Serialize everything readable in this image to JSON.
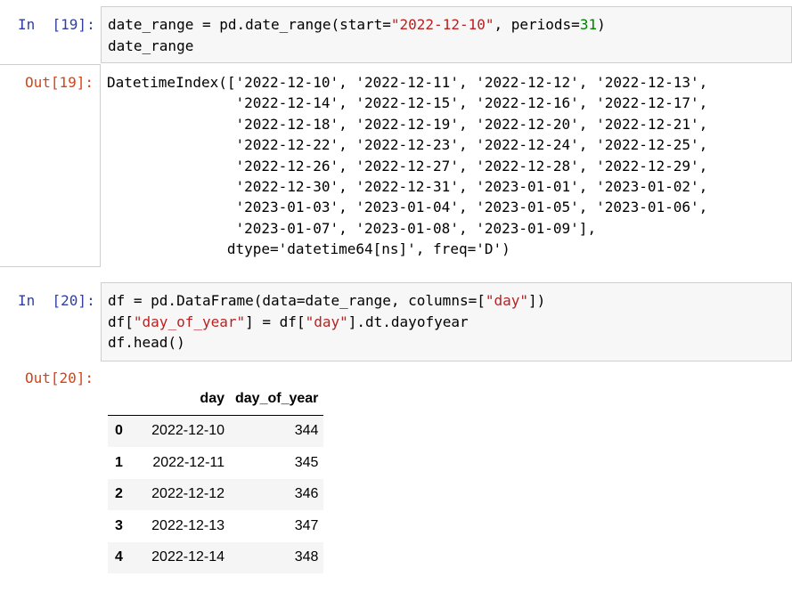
{
  "cell19": {
    "in_prompt": "In  [19]:",
    "out_prompt": "Out[19]:",
    "code_l1_a": "date_range = pd.date_range(start=",
    "code_l1_str": "\"2022-12-10\"",
    "code_l1_b": ", periods=",
    "code_l1_num": "31",
    "code_l1_c": ")",
    "code_l2": "date_range",
    "output_lines": [
      "DatetimeIndex(['2022-12-10', '2022-12-11', '2022-12-12', '2022-12-13',",
      "               '2022-12-14', '2022-12-15', '2022-12-16', '2022-12-17',",
      "               '2022-12-18', '2022-12-19', '2022-12-20', '2022-12-21',",
      "               '2022-12-22', '2022-12-23', '2022-12-24', '2022-12-25',",
      "               '2022-12-26', '2022-12-27', '2022-12-28', '2022-12-29',",
      "               '2022-12-30', '2022-12-31', '2023-01-01', '2023-01-02',",
      "               '2023-01-03', '2023-01-04', '2023-01-05', '2023-01-06',",
      "               '2023-01-07', '2023-01-08', '2023-01-09'],",
      "              dtype='datetime64[ns]', freq='D')"
    ]
  },
  "cell20": {
    "in_prompt": "In  [20]:",
    "out_prompt": "Out[20]:",
    "l1_a": "df = pd.DataFrame(data=date_range, columns=[",
    "l1_str": "\"day\"",
    "l1_b": "])",
    "l2_a": "df[",
    "l2_str1": "\"day_of_year\"",
    "l2_b": "] = df[",
    "l2_str2": "\"day\"",
    "l2_c": "].dt.dayofyear",
    "l3": "df.head()",
    "table": {
      "columns": [
        "",
        "day",
        "day_of_year"
      ],
      "rows": [
        {
          "index": "0",
          "day": "2022-12-10",
          "day_of_year": "344"
        },
        {
          "index": "1",
          "day": "2022-12-11",
          "day_of_year": "345"
        },
        {
          "index": "2",
          "day": "2022-12-12",
          "day_of_year": "346"
        },
        {
          "index": "3",
          "day": "2022-12-13",
          "day_of_year": "347"
        },
        {
          "index": "4",
          "day": "2022-12-14",
          "day_of_year": "348"
        }
      ]
    }
  }
}
